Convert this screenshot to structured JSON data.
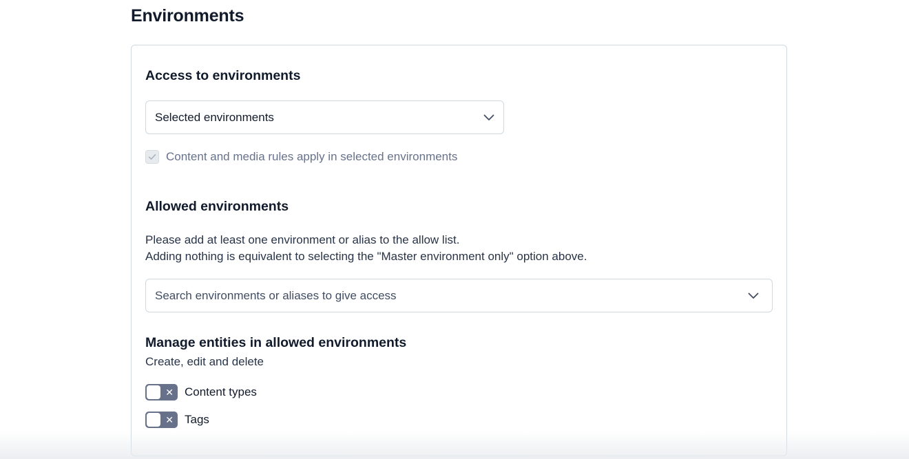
{
  "page": {
    "title": "Environments"
  },
  "access": {
    "heading": "Access to environments",
    "select_value": "Selected environments",
    "checkbox_label": "Content and media rules apply in selected environments",
    "checkbox_checked": true,
    "checkbox_disabled": true
  },
  "allowed": {
    "heading": "Allowed environments",
    "desc_line1": "Please add at least one environment or alias to the allow list.",
    "desc_line2": "Adding nothing is equivalent to selecting the \"Master environment only\" option above.",
    "search_placeholder": "Search environments or aliases to give access"
  },
  "manage": {
    "heading": "Manage entities in allowed environments",
    "subtext": "Create, edit and delete",
    "toggles": [
      {
        "label": "Content types",
        "on": false
      },
      {
        "label": "Tags",
        "on": false
      }
    ]
  },
  "icons": {
    "select_chevron": "chevron-down-icon",
    "search_chevron": "chevron-down-icon",
    "checkbox_check": "check-icon",
    "toggle_off": "close-icon"
  },
  "colors": {
    "text": "#111b2b",
    "muted": "#67728a",
    "border": "#cfd9e0",
    "toggle_off": "#67728a"
  }
}
